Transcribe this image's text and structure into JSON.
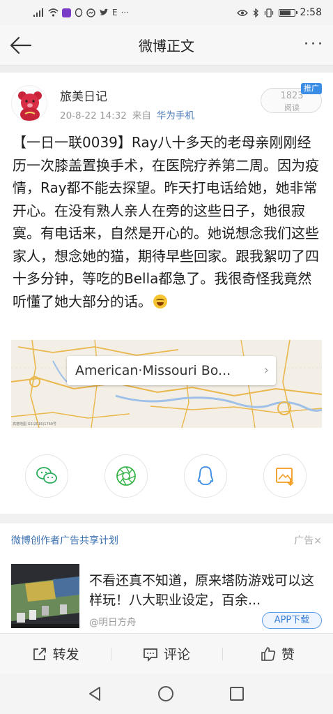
{
  "status_bar": {
    "time": "2:58",
    "left_icons": [
      "signal-icon",
      "wifi-icon",
      "app-icon",
      "qq-icon",
      "messenger-icon",
      "twitter-icon",
      "e-icon",
      "more-icon"
    ],
    "e_glyph": "E",
    "more_glyph": "···",
    "right_icons": [
      "eye-icon",
      "bluetooth-icon",
      "vibrate-icon",
      "battery-icon"
    ],
    "battery_level": 0.8
  },
  "nav": {
    "title": "微博正文",
    "back_icon": "back-arrow-icon",
    "more_icon": "more-dots-icon",
    "more_glyph": "···"
  },
  "post": {
    "author": "旅美日记",
    "time": "20-8-22 14:32",
    "source_prefix": "来自",
    "source": "华为手机",
    "read_count": "1823",
    "read_label": "阅读",
    "promo_badge": "推广",
    "text": "【一日一联0039】Ray八十多天的老母亲刚刚经历一次膝盖置换手术，在医院疗养第二周。因为疫情，Ray都不能去探望。昨天打电话给她，她非常开心。在没有熟人亲人在旁的这些日子，她很寂寞。有电话来，自然是开心的。她说想念我们这些家人，想念她的猫，期待早些回家。跟我絮叨了四十多分钟，等吃的Bella都急了。我很奇怪我竟然听懂了她大部分的话。",
    "emoji": "laugh-cry-emoji"
  },
  "map": {
    "location": "American·Missouri Bo...",
    "arrow": "›",
    "copyright": "高德地图 GS(2016)1769号"
  },
  "share": [
    {
      "name": "wechat-icon",
      "color": "#2bad5b"
    },
    {
      "name": "moments-icon",
      "color": "#39b54a"
    },
    {
      "name": "qq-icon",
      "color": "#3b8ce4"
    },
    {
      "name": "save-image-icon",
      "color": "#f39a1d"
    }
  ],
  "ad": {
    "header": "微博创作者广告共享计划",
    "tag": "广告",
    "close_glyph": "×",
    "title": "不看还真不知道，原来塔防游戏可以这样玩！八大职业设定，百余...",
    "account": "@明日方舟",
    "button": "APP下载"
  },
  "actions": {
    "repost": "转发",
    "comment": "评论",
    "like": "赞"
  },
  "colors": {
    "accent_blue": "#3a7fd6",
    "link_blue": "#4a7bb7"
  }
}
